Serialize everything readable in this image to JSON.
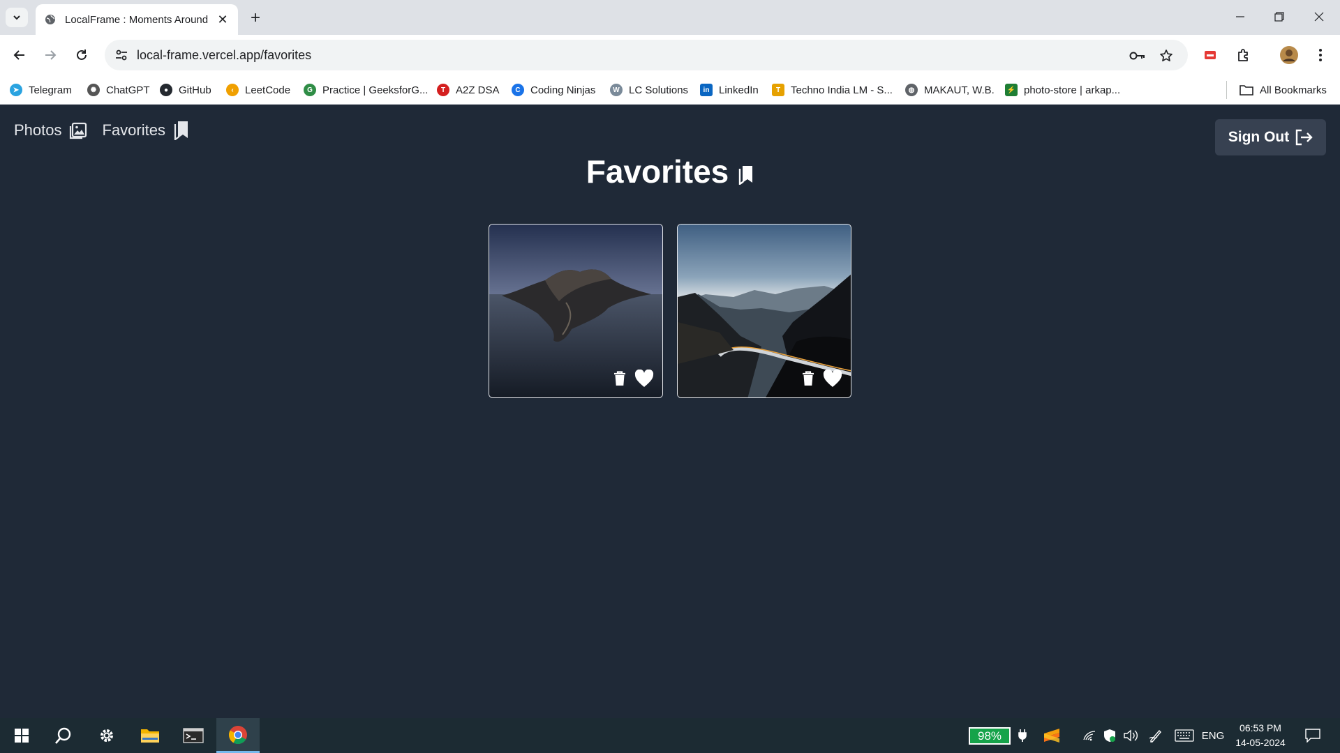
{
  "browser": {
    "tab_title": "LocalFrame : Moments Around",
    "url": "local-frame.vercel.app/favorites",
    "bookmarks": [
      {
        "label": "Telegram",
        "icon": "telegram-icon",
        "color": "#2aa3e0"
      },
      {
        "label": "ChatGPT",
        "icon": "chatgpt-icon",
        "color": "#555555"
      },
      {
        "label": "GitHub",
        "icon": "github-icon",
        "color": "#24292f"
      },
      {
        "label": "LeetCode",
        "icon": "leetcode-icon",
        "color": "#f0a000"
      },
      {
        "label": "Practice | GeeksforG...",
        "icon": "geeksforgeeks-icon",
        "color": "#2f8d46"
      },
      {
        "label": "A2Z DSA",
        "icon": "tuf-icon",
        "color": "#d41f1f"
      },
      {
        "label": "Coding Ninjas",
        "icon": "coding-ninjas-icon",
        "color": "#1a73e8"
      },
      {
        "label": "LC Solutions",
        "icon": "walkccc-icon",
        "color": "#7a8a99"
      },
      {
        "label": "LinkedIn",
        "icon": "linkedin-icon",
        "color": "#0a66c2"
      },
      {
        "label": "Techno India LM - S...",
        "icon": "techno-india-icon",
        "color": "#e6a100"
      },
      {
        "label": "MAKAUT, W.B.",
        "icon": "globe-icon",
        "color": "#5f6368"
      },
      {
        "label": "photo-store | arkap...",
        "icon": "photo-store-icon",
        "color": "#1e7e34"
      }
    ],
    "all_bookmarks": "All Bookmarks"
  },
  "app": {
    "nav": [
      {
        "label": "Photos",
        "icon": "photos-icon"
      },
      {
        "label": "Favorites",
        "icon": "bookmark-icon"
      }
    ],
    "sign_out": "Sign Out",
    "page_title": "Favorites",
    "cards": [
      {
        "name": "island-at-dusk-photo",
        "actions": [
          "trash-icon",
          "heart-icon"
        ]
      },
      {
        "name": "mountain-road-photo",
        "actions": [
          "trash-icon",
          "heart-icon"
        ]
      }
    ],
    "colors": {
      "background": "#1f2937",
      "button": "#374151",
      "text": "#ffffff"
    }
  },
  "taskbar": {
    "battery": "98%",
    "language": "ENG",
    "time": "06:53 PM",
    "date": "14-05-2024"
  }
}
